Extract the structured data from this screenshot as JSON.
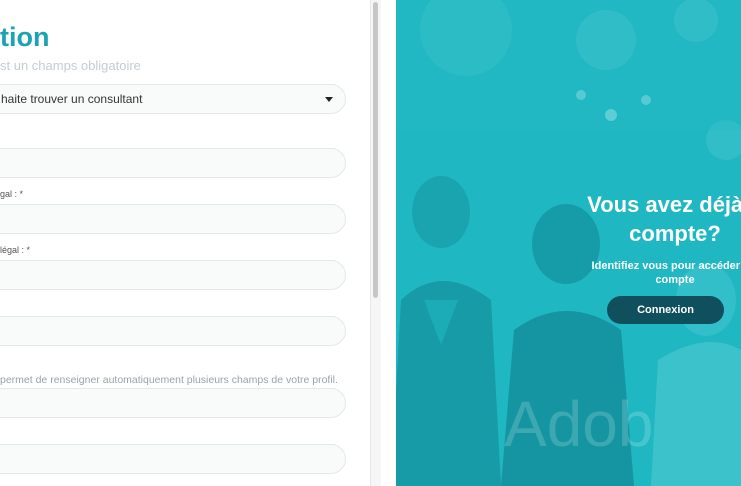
{
  "form": {
    "title": "tion",
    "required_note": "st un champs obligatoire",
    "select_value": "haite trouver un consultant",
    "labels": {
      "label_1": "gal : *",
      "label_2": " légal : *"
    },
    "hint": "permet de renseigner automatiquement plusieurs champs de votre profil."
  },
  "promo": {
    "title_line_1": "Vous avez déjà u",
    "title_line_2": "compte?",
    "subtitle_line_1": "Identifiez vous pour accéder à v",
    "subtitle_line_2": "compte",
    "connexion_label": "Connexion",
    "watermark": "Adob"
  },
  "colors": {
    "accent": "#1aa3b3",
    "promo_background": "#1fb7c2",
    "button_background": "#0f4f5e"
  }
}
